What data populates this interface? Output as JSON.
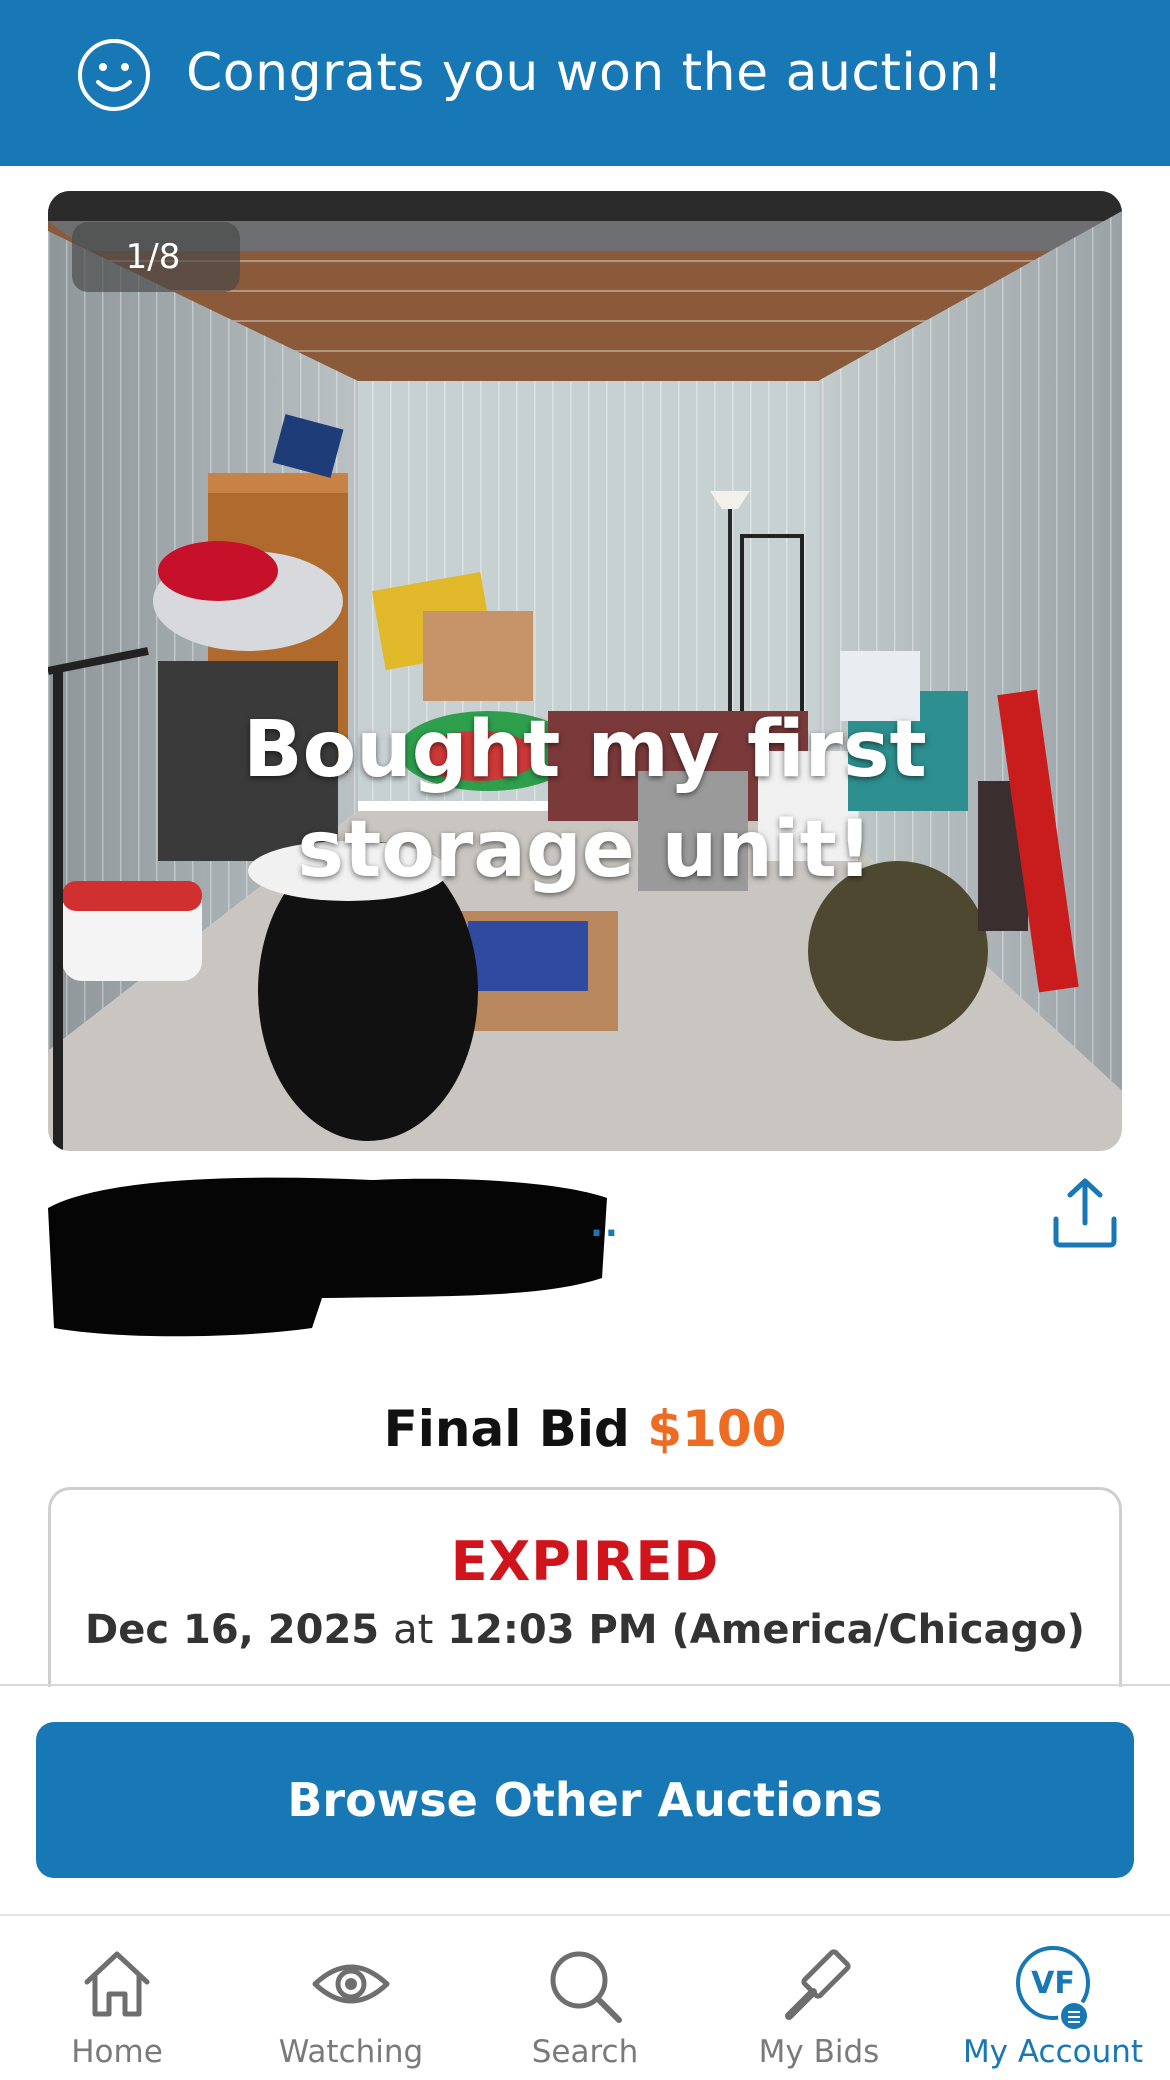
{
  "banner": {
    "title": "Congrats you won the auction!",
    "icon": "smiley-face-icon"
  },
  "photo": {
    "counter": "1/8",
    "caption": "Bought my first storage unit!"
  },
  "listing": {
    "title_truncation": "..",
    "share_icon": "share-icon"
  },
  "bid": {
    "label": "Final Bid",
    "amount": "$100",
    "amount_color": "#ee6b23"
  },
  "status": {
    "state": "EXPIRED",
    "date": "Dec 16, 2025",
    "at": "at",
    "time": "12:03 PM (America/Chicago)",
    "state_color": "#d0141c"
  },
  "actions": {
    "browse_label": "Browse Other Auctions"
  },
  "nav": {
    "items": [
      {
        "label": "Home",
        "icon": "home-icon"
      },
      {
        "label": "Watching",
        "icon": "eye-icon"
      },
      {
        "label": "Search",
        "icon": "search-icon"
      },
      {
        "label": "My Bids",
        "icon": "gavel-icon"
      },
      {
        "label": "My Account",
        "icon": "avatar",
        "avatar_initials": "VF",
        "active": true
      }
    ]
  },
  "colors": {
    "brand": "#1877b5"
  }
}
